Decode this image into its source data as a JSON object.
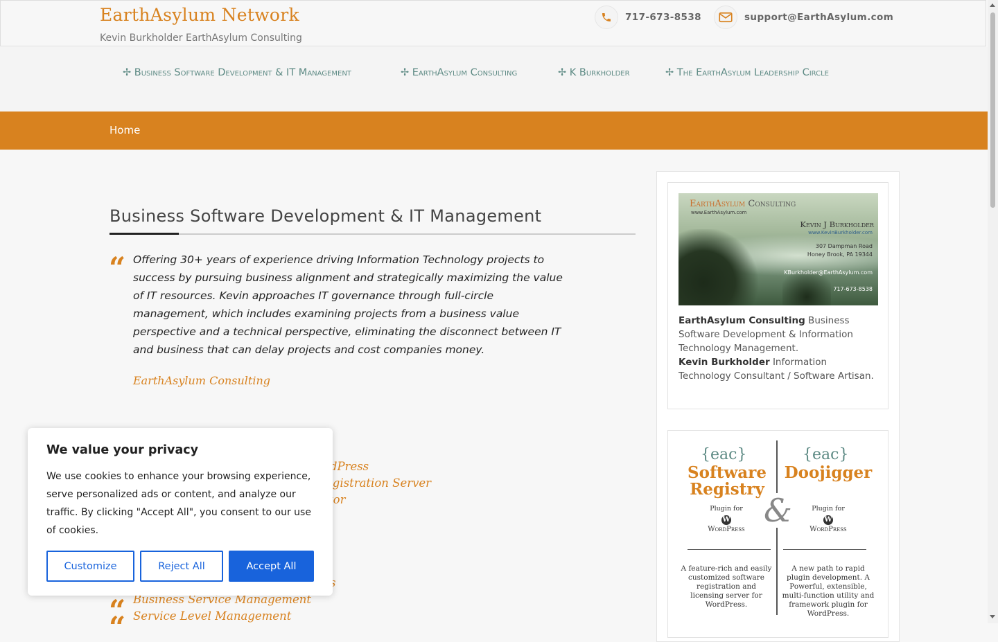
{
  "header": {
    "site_title": "EarthAsylum Network",
    "site_desc": "Kevin Burkholder  EarthAsylum Consulting",
    "phone": "717-673-8538",
    "email": "support@EarthAsylum.com",
    "phone_icon": "phone-icon",
    "email_icon": "envelope-icon"
  },
  "nav": {
    "items": [
      "✢ Business Software Development & IT Management",
      "✢ EarthAsylum Consulting",
      "✢ K Burkholder",
      "✢ The EarthAsylum Leadership Circle"
    ]
  },
  "subnav": {
    "home": "Home"
  },
  "main": {
    "title": "Business Software Development & IT Management",
    "quote_mark": "“",
    "quote": "Offering 30+ years of experience driving Information Technology projects to success by pursuing business alignment and strategically maximizing the value of IT resources. Kevin approaches IT governance through full-circle management, which includes examining projects from a business value perspective and a technical perspective, eliminating the disconnect between IT and business that can delay projects and cost companies money.",
    "quote_cite": "EarthAsylum Consulting",
    "partial_links": [
      "rdPress",
      "egistration Server",
      "tor",
      "s"
    ],
    "list_items": [
      "Business Service Management",
      "Service Level Management"
    ]
  },
  "sidebar": {
    "card": {
      "company_a": "EarthAsylum",
      "company_b": "Consulting",
      "site": "www.EarthAsylum.com",
      "name": "Kevin J Burkholder",
      "site2": "www.KevinBurkholder.com",
      "addr1": "307 Dampman Road",
      "addr2": "Honey Brook, PA 19344",
      "email": "KBurkholder@EarthAsylum.com",
      "phone": "717-673-8538"
    },
    "text": {
      "consulting_strong": "EarthAsylum Consulting",
      "consulting_rest": "  Business Software Development & Information Technology Management.",
      "kevin_strong": "Kevin Burkholder",
      "kevin_rest": "  Information Technology Consultant / Software Artisan."
    },
    "promo": {
      "eac": "{eac}",
      "left_title": "Software\nRegistry",
      "right_title": "Doojigger",
      "plugin_for": "Plugin for",
      "wordpress": "WordPress",
      "wp_glyph": "W",
      "amp": "&",
      "left_desc": "A feature-rich and easily customized software registration and licensing server for WordPress.",
      "right_desc": "A new path to rapid plugin development. A Powerful, extensible, multi-function utility and framework plugin for WordPress."
    }
  },
  "cookie": {
    "title": "We value your privacy",
    "body": "We use cookies to enhance your browsing experience, serve personalized ads or content, and analyze our traffic. By clicking \"Accept All\", you consent to our use of cookies.",
    "customize": "Customize",
    "reject": "Reject All",
    "accept": "Accept All"
  },
  "colors": {
    "accent": "#d8821f",
    "nav_text": "#5d8a84",
    "cookie_primary": "#1863dc"
  }
}
